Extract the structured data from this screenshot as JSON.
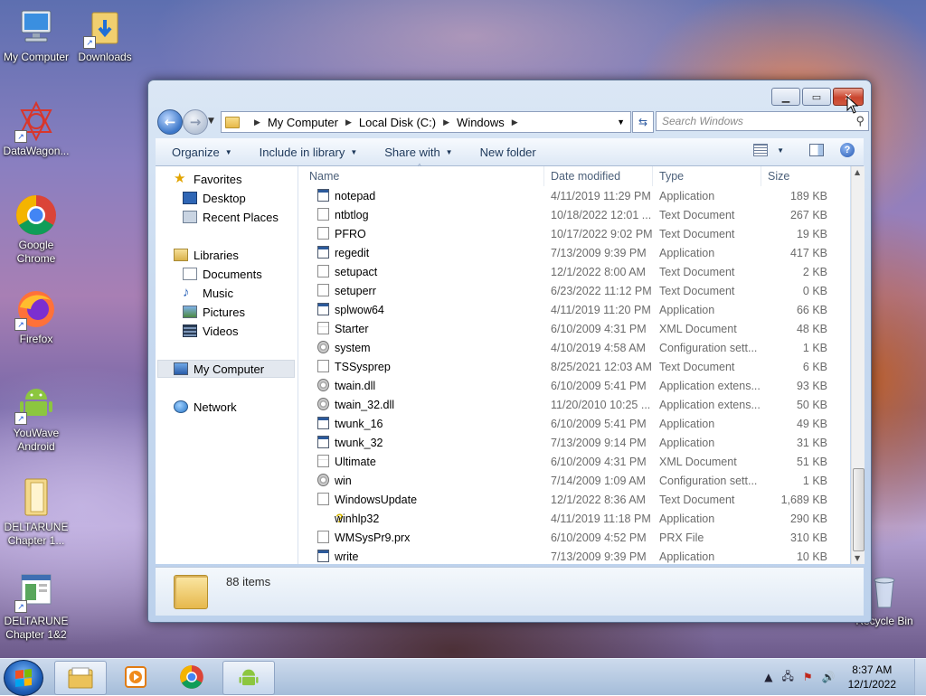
{
  "desktop": {
    "icons": [
      {
        "label": "My Computer"
      },
      {
        "label": "Downloads"
      },
      {
        "label": "DataWagon..."
      },
      {
        "label": "Google Chrome"
      },
      {
        "label": "Firefox"
      },
      {
        "label": "YouWave Android"
      },
      {
        "label": "DELTARUNE Chapter 1..."
      },
      {
        "label": "DELTARUNE Chapter 1&2"
      },
      {
        "label": "Recycle Bin"
      }
    ]
  },
  "window": {
    "address": {
      "crumbs": [
        "My Computer",
        "Local Disk (C:)",
        "Windows"
      ]
    },
    "search": {
      "placeholder": "Search Windows"
    },
    "toolbar": {
      "organize": "Organize",
      "include_in_library": "Include in library",
      "share_with": "Share with",
      "new_folder": "New folder"
    },
    "nav_pane": {
      "favorites": "Favorites",
      "desktop": "Desktop",
      "recent_places": "Recent Places",
      "libraries": "Libraries",
      "documents": "Documents",
      "music": "Music",
      "pictures": "Pictures",
      "videos": "Videos",
      "my_computer": "My Computer",
      "network": "Network"
    },
    "columns": {
      "name": "Name",
      "date": "Date modified",
      "type": "Type",
      "size": "Size"
    },
    "files": [
      {
        "name": "notepad",
        "date": "4/11/2019 11:29 PM",
        "type": "Application",
        "size": "189 KB"
      },
      {
        "name": "ntbtlog",
        "date": "10/18/2022 12:01 ...",
        "type": "Text Document",
        "size": "267 KB"
      },
      {
        "name": "PFRO",
        "date": "10/17/2022 9:02 PM",
        "type": "Text Document",
        "size": "19 KB"
      },
      {
        "name": "regedit",
        "date": "7/13/2009 9:39 PM",
        "type": "Application",
        "size": "417 KB"
      },
      {
        "name": "setupact",
        "date": "12/1/2022 8:00 AM",
        "type": "Text Document",
        "size": "2 KB"
      },
      {
        "name": "setuperr",
        "date": "6/23/2022 11:12 PM",
        "type": "Text Document",
        "size": "0 KB"
      },
      {
        "name": "splwow64",
        "date": "4/11/2019 11:20 PM",
        "type": "Application",
        "size": "66 KB"
      },
      {
        "name": "Starter",
        "date": "6/10/2009 4:31 PM",
        "type": "XML Document",
        "size": "48 KB"
      },
      {
        "name": "system",
        "date": "4/10/2019 4:58 AM",
        "type": "Configuration sett...",
        "size": "1 KB"
      },
      {
        "name": "TSSysprep",
        "date": "8/25/2021 12:03 AM",
        "type": "Text Document",
        "size": "6 KB"
      },
      {
        "name": "twain.dll",
        "date": "6/10/2009 5:41 PM",
        "type": "Application extens...",
        "size": "93 KB"
      },
      {
        "name": "twain_32.dll",
        "date": "11/20/2010 10:25 ...",
        "type": "Application extens...",
        "size": "50 KB"
      },
      {
        "name": "twunk_16",
        "date": "6/10/2009 5:41 PM",
        "type": "Application",
        "size": "49 KB"
      },
      {
        "name": "twunk_32",
        "date": "7/13/2009 9:14 PM",
        "type": "Application",
        "size": "31 KB"
      },
      {
        "name": "Ultimate",
        "date": "6/10/2009 4:31 PM",
        "type": "XML Document",
        "size": "51 KB"
      },
      {
        "name": "win",
        "date": "7/14/2009 1:09 AM",
        "type": "Configuration sett...",
        "size": "1 KB"
      },
      {
        "name": "WindowsUpdate",
        "date": "12/1/2022 8:36 AM",
        "type": "Text Document",
        "size": "1,689 KB"
      },
      {
        "name": "winhlp32",
        "date": "4/11/2019 11:18 PM",
        "type": "Application",
        "size": "290 KB"
      },
      {
        "name": "WMSysPr9.prx",
        "date": "6/10/2009 4:52 PM",
        "type": "PRX File",
        "size": "310 KB"
      },
      {
        "name": "write",
        "date": "7/13/2009 9:39 PM",
        "type": "Application",
        "size": "10 KB"
      }
    ],
    "details": {
      "count": "88 items"
    }
  },
  "taskbar": {
    "clock_time": "8:37 AM",
    "clock_date": "12/1/2022"
  },
  "colors": {
    "close_button": "#c9452e",
    "accent": "#1e5fb9",
    "toolbar_text": "#1e395b"
  }
}
